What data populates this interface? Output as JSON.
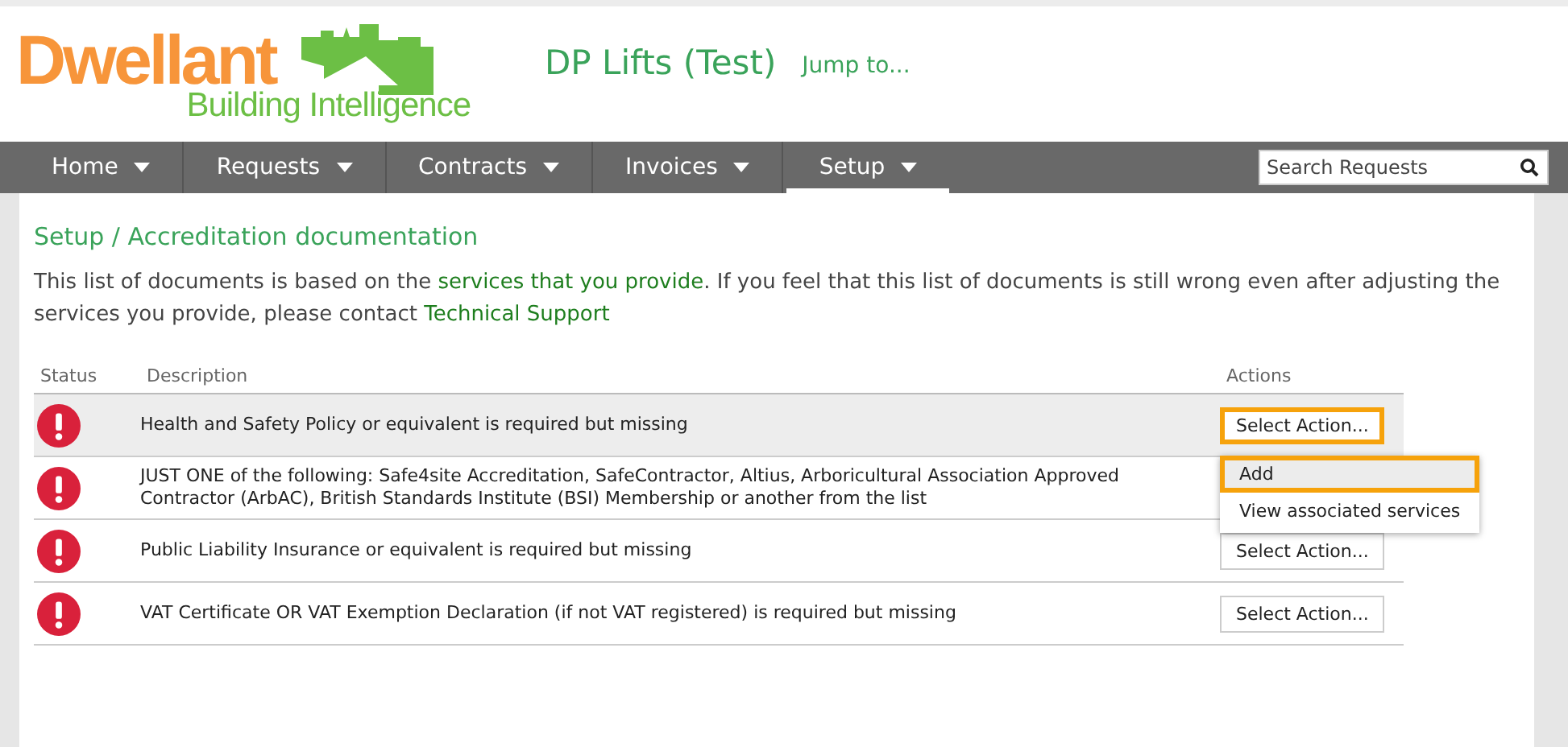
{
  "logo": {
    "name": "Dwellant",
    "tagline": "Building Intelligence"
  },
  "header": {
    "title": "DP Lifts (Test)",
    "jump_link": "Jump to..."
  },
  "nav": [
    {
      "label": "Home",
      "selected": false
    },
    {
      "label": "Requests",
      "selected": false
    },
    {
      "label": "Contracts",
      "selected": false
    },
    {
      "label": "Invoices",
      "selected": false
    },
    {
      "label": "Setup",
      "selected": true
    }
  ],
  "search": {
    "placeholder": "Search Requests"
  },
  "breadcrumb": "Setup / Accreditation documentation",
  "intro": [
    {
      "kind": "text",
      "text": "This list of documents is based on the "
    },
    {
      "kind": "link",
      "text": "services that you provide"
    },
    {
      "kind": "text",
      "text": ". If you feel that this list of documents is still wrong even after adjusting the services you provide, please contact "
    },
    {
      "kind": "link",
      "text": "Technical Support"
    }
  ],
  "table": {
    "columns": [
      "Status",
      "Description",
      "Actions"
    ],
    "rows": [
      {
        "kind": "missing",
        "description": "Health and Safety Policy or equivalent is required but missing",
        "action": "Select Action...",
        "selected": true
      },
      {
        "kind": "missing",
        "description": "JUST ONE of the following: Safe4site Accreditation, SafeContractor, Altius, Arboricultural Association Approved Contractor (ArbAC), British Standards Institute (BSI) Membership or another from the list",
        "selected": false
      },
      {
        "kind": "missing",
        "description": "Public Liability Insurance or equivalent is required but missing",
        "action": "Select Action...",
        "selected": false
      },
      {
        "kind": "missing",
        "description": "VAT Certificate OR VAT Exemption Declaration (if not VAT registered) is required but missing",
        "action": "Select Action...",
        "selected": false
      }
    ]
  },
  "action_menu": {
    "items": [
      {
        "label": "Add",
        "selected": true
      },
      {
        "label": "View associated services",
        "selected": false
      }
    ]
  }
}
